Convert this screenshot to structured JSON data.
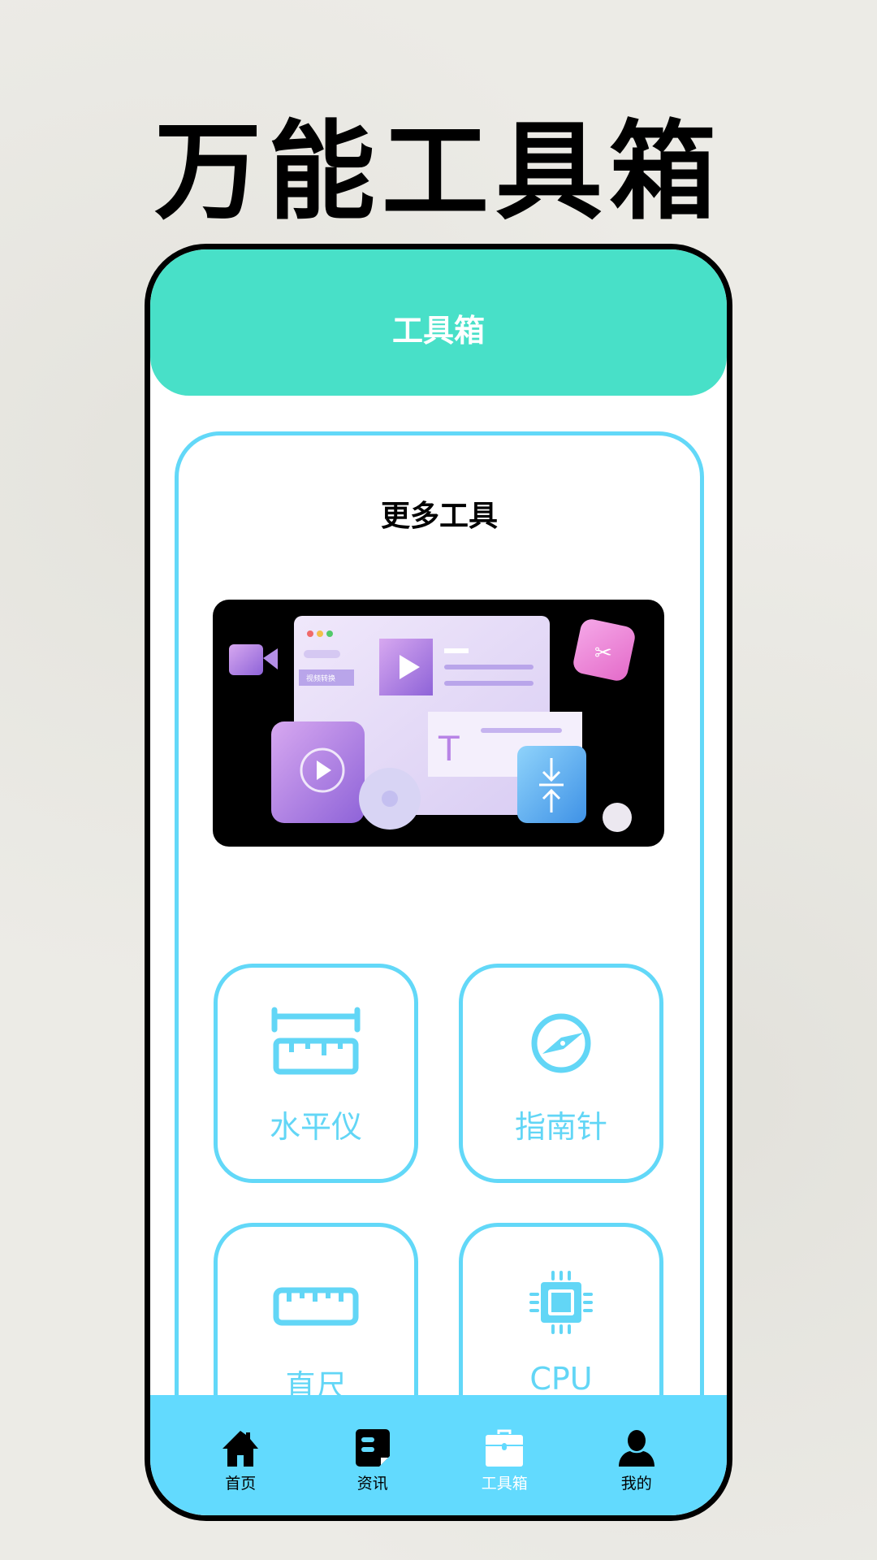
{
  "promo_title": "万能工具箱",
  "header": {
    "title": "工具箱"
  },
  "card": {
    "title": "更多工具",
    "banner": {
      "lettering": "视频转换"
    },
    "tools": [
      {
        "label": "水平仪",
        "icon": "level-icon"
      },
      {
        "label": "指南针",
        "icon": "compass-icon"
      },
      {
        "label": "直尺",
        "icon": "ruler-icon"
      },
      {
        "label": "CPU",
        "icon": "cpu-icon"
      }
    ]
  },
  "nav": {
    "items": [
      {
        "label": "首页",
        "icon": "home-icon"
      },
      {
        "label": "资讯",
        "icon": "news-icon"
      },
      {
        "label": "工具箱",
        "icon": "toolbox-icon",
        "active": true
      },
      {
        "label": "我的",
        "icon": "user-icon"
      }
    ]
  },
  "colors": {
    "header": "#48e0c8",
    "accent": "#62d8f8",
    "nav": "#62dafe"
  }
}
